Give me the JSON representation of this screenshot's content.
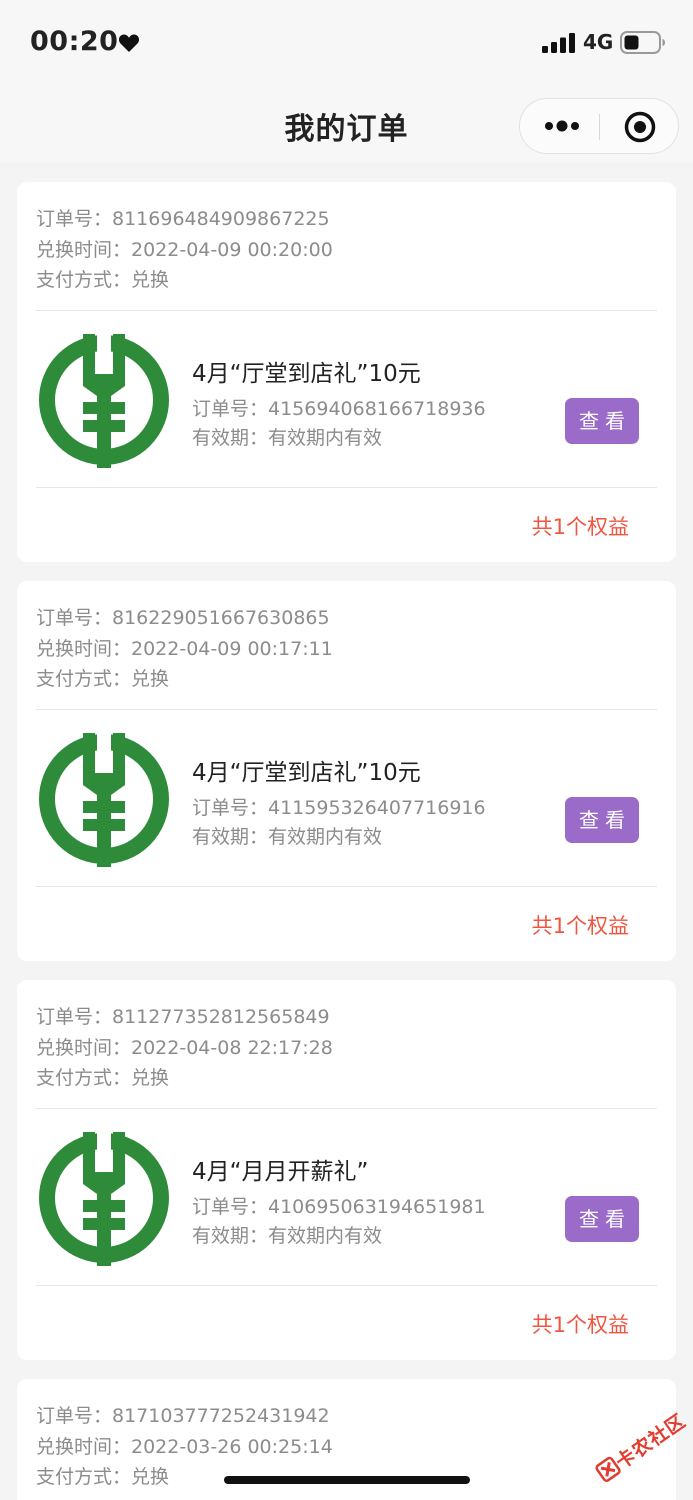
{
  "status_bar": {
    "time": "00:20",
    "network": "4G",
    "icons": [
      "heart-icon",
      "signal-icon",
      "battery-icon"
    ]
  },
  "nav": {
    "title": "我的订单",
    "icons": [
      "more-icon",
      "close-icon"
    ]
  },
  "colors": {
    "accent_button": "#9b6bc9",
    "count_text": "#f0553f",
    "logo_green": "#2e8b3a"
  },
  "orders": [
    {
      "order_no_label": "订单号：811696484909867225",
      "exchange_time": "兑换时间：2022-04-09 00:20:00",
      "payment": "支付方式：兑换",
      "item_title": "4月“厅堂到店礼”10元",
      "item_order_no": "订单号：415694068166718936",
      "validity": "有效期：有效期内有效",
      "button": "查看",
      "count": "共1个权益"
    },
    {
      "order_no_label": "订单号：816229051667630865",
      "exchange_time": "兑换时间：2022-04-09 00:17:11",
      "payment": "支付方式：兑换",
      "item_title": "4月“厅堂到店礼”10元",
      "item_order_no": "订单号：411595326407716916",
      "validity": "有效期：有效期内有效",
      "button": "查看",
      "count": "共1个权益"
    },
    {
      "order_no_label": "订单号：811277352812565849",
      "exchange_time": "兑换时间：2022-04-08 22:17:28",
      "payment": "支付方式：兑换",
      "item_title": "4月“月月开薪礼”",
      "item_order_no": "订单号：410695063194651981",
      "validity": "有效期：有效期内有效",
      "button": "查看",
      "count": "共1个权益"
    },
    {
      "order_no_label": "订单号：817103777252431942",
      "exchange_time": "兑换时间：2022-03-26 00:25:14",
      "payment": "支付方式：兑换"
    }
  ],
  "watermark": {
    "text": "卡农社区"
  }
}
